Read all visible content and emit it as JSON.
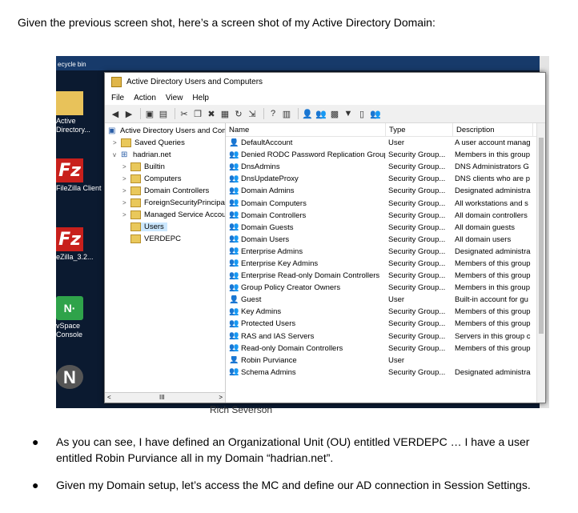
{
  "intro_text": "Given the previous screen shot, here’s a screen shot of my Active Directory Domain:",
  "desktop": {
    "top_label": "ecycle bin",
    "icons": [
      {
        "label": "Active Directory...",
        "icon": "folder-icon"
      },
      {
        "label": "FileZilla Client",
        "icon": "filezilla-icon"
      },
      {
        "label": "eZilla_3.2...",
        "icon": "filezilla-icon"
      },
      {
        "label": "vSpace Console",
        "icon": "vspace-icon"
      },
      {
        "label": "",
        "icon": "n-icon"
      }
    ],
    "behind_text": "Rich Severson"
  },
  "window": {
    "title": "Active Directory Users and Computers",
    "menu": [
      "File",
      "Action",
      "View",
      "Help"
    ],
    "tree": {
      "root": "Active Directory Users and Com",
      "items": [
        {
          "label": "Saved Queries",
          "level": 1,
          "expander": ">"
        },
        {
          "label": "hadrian.net",
          "level": 1,
          "expander": "v"
        },
        {
          "label": "Builtin",
          "level": 2,
          "expander": ">"
        },
        {
          "label": "Computers",
          "level": 2,
          "expander": ">"
        },
        {
          "label": "Domain Controllers",
          "level": 2,
          "expander": ">"
        },
        {
          "label": "ForeignSecurityPrincipals",
          "level": 2,
          "expander": ">"
        },
        {
          "label": "Managed Service Accoun",
          "level": 2,
          "expander": ">"
        },
        {
          "label": "Users",
          "level": 2,
          "expander": "",
          "selected": true
        },
        {
          "label": "VERDEPC",
          "level": 2,
          "expander": ""
        }
      ]
    },
    "columns": [
      "Name",
      "Type",
      "Description"
    ],
    "rows": [
      {
        "name": "DefaultAccount",
        "type": "User",
        "desc": "A user account manag",
        "icon": "user"
      },
      {
        "name": "Denied RODC Password Replication Group",
        "type": "Security Group...",
        "desc": "Members in this group",
        "icon": "group"
      },
      {
        "name": "DnsAdmins",
        "type": "Security Group...",
        "desc": "DNS Administrators G",
        "icon": "group"
      },
      {
        "name": "DnsUpdateProxy",
        "type": "Security Group...",
        "desc": "DNS clients who are p",
        "icon": "group"
      },
      {
        "name": "Domain Admins",
        "type": "Security Group...",
        "desc": "Designated administra",
        "icon": "group"
      },
      {
        "name": "Domain Computers",
        "type": "Security Group...",
        "desc": "All workstations and s",
        "icon": "group"
      },
      {
        "name": "Domain Controllers",
        "type": "Security Group...",
        "desc": "All domain controllers",
        "icon": "group"
      },
      {
        "name": "Domain Guests",
        "type": "Security Group...",
        "desc": "All domain guests",
        "icon": "group"
      },
      {
        "name": "Domain Users",
        "type": "Security Group...",
        "desc": "All domain users",
        "icon": "group"
      },
      {
        "name": "Enterprise Admins",
        "type": "Security Group...",
        "desc": "Designated administra",
        "icon": "group"
      },
      {
        "name": "Enterprise Key Admins",
        "type": "Security Group...",
        "desc": "Members of this group",
        "icon": "group"
      },
      {
        "name": "Enterprise Read-only Domain Controllers",
        "type": "Security Group...",
        "desc": "Members of this group",
        "icon": "group"
      },
      {
        "name": "Group Policy Creator Owners",
        "type": "Security Group...",
        "desc": "Members in this group",
        "icon": "group"
      },
      {
        "name": "Guest",
        "type": "User",
        "desc": "Built-in account for gu",
        "icon": "user"
      },
      {
        "name": "Key Admins",
        "type": "Security Group...",
        "desc": "Members of this group",
        "icon": "group"
      },
      {
        "name": "Protected Users",
        "type": "Security Group...",
        "desc": "Members of this group",
        "icon": "group"
      },
      {
        "name": "RAS and IAS Servers",
        "type": "Security Group...",
        "desc": "Servers in this group c",
        "icon": "group"
      },
      {
        "name": "Read-only Domain Controllers",
        "type": "Security Group...",
        "desc": "Members of this group",
        "icon": "group"
      },
      {
        "name": "Robin Purviance",
        "type": "User",
        "desc": "",
        "icon": "user"
      },
      {
        "name": "Schema Admins",
        "type": "Security Group...",
        "desc": "Designated administra",
        "icon": "group"
      }
    ]
  },
  "bullets": [
    "As you can see, I have defined an Organizational Unit (OU) entitled VERDEPC … I have a user entitled Robin Purviance all in my Domain “hadrian.net”.",
    "Given my Domain setup, let’s access the MC and define our AD connection in Session Settings."
  ]
}
